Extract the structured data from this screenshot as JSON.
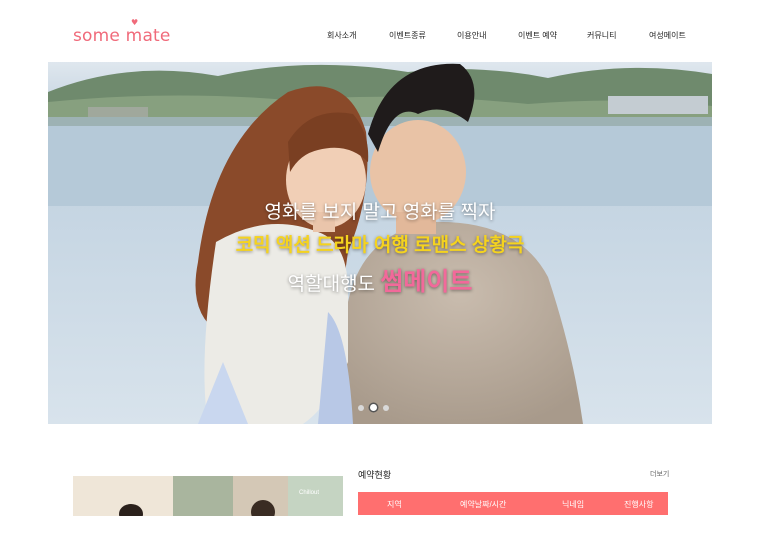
{
  "header": {
    "logo_text": "some mate",
    "logo_heart": "♥",
    "nav": [
      "회사소개",
      "이벤트종류",
      "이용안내",
      "이벤트 예약",
      "커뮤니티",
      "여성메이트"
    ]
  },
  "hero": {
    "line1": "영화를 보지 말고 영화를 찍자",
    "line2": "코믹 액션 드라마 여행 로맨스 상황극",
    "line3_prefix": "역할대행도 ",
    "line3_brand": "썸메이트",
    "slide_count": 3,
    "active_slide": 2
  },
  "reservation": {
    "title": "예약현황",
    "more": "더보기",
    "columns": [
      "지역",
      "예약날짜/시간",
      "닉네임",
      "진행사항"
    ]
  },
  "thumbnail_caption": "Chillout",
  "colors": {
    "brand_pink": "#f06a7a",
    "table_header": "#ff6f6f",
    "slogan_yellow": "#f5d31e"
  }
}
